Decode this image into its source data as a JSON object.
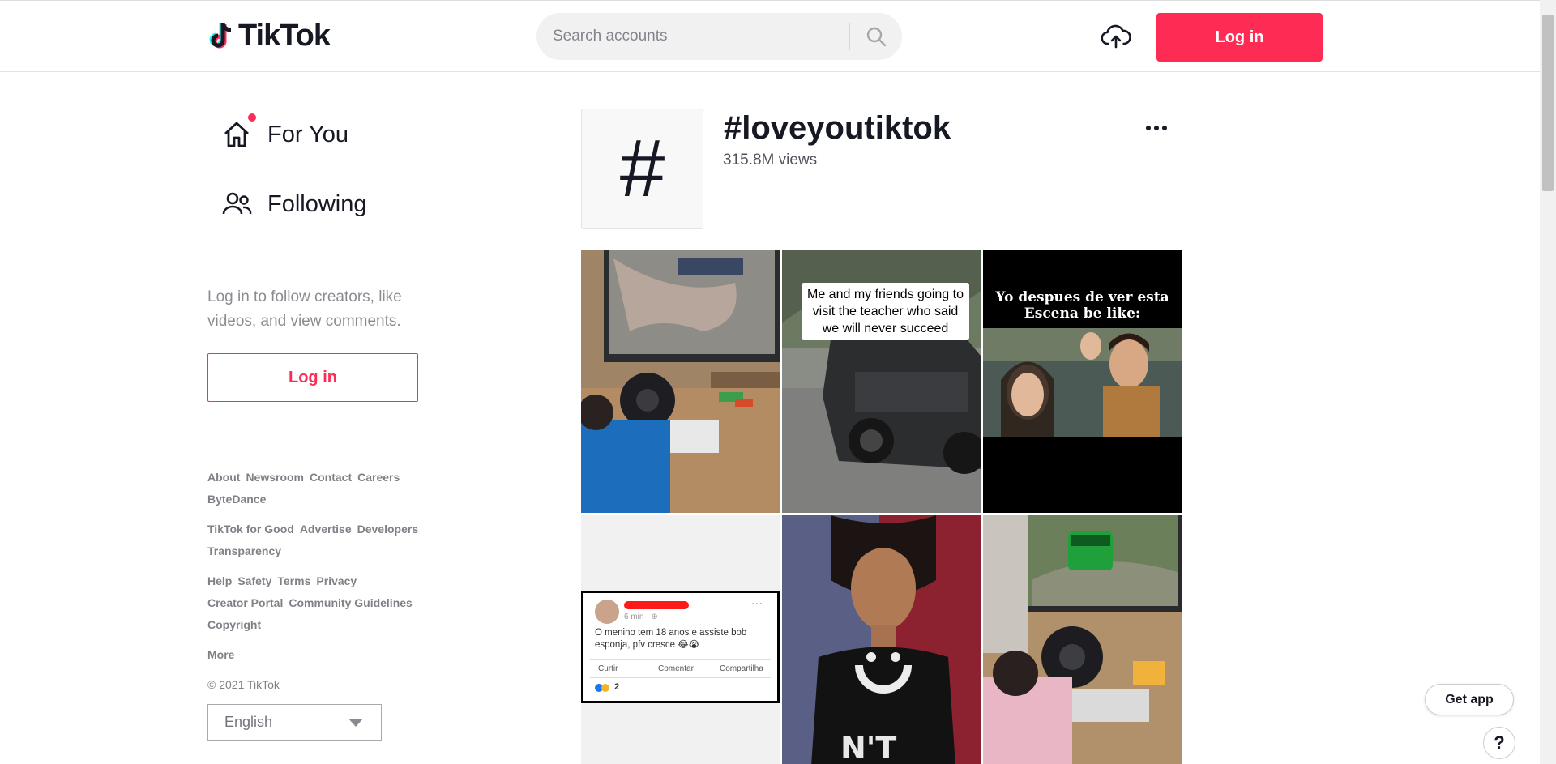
{
  "header": {
    "logo": "TikTok",
    "search_placeholder": "Search accounts",
    "login_label": "Log in"
  },
  "sidebar": {
    "nav": [
      {
        "label": "For You",
        "icon": "home-icon"
      },
      {
        "label": "Following",
        "icon": "users-icon"
      }
    ],
    "login_hint": "Log in to follow creators, like videos, and view comments.",
    "login_label": "Log in",
    "footer_rows": [
      [
        "About",
        "Newsroom",
        "Contact",
        "Careers",
        "ByteDance"
      ],
      [
        "TikTok for Good",
        "Advertise",
        "Developers",
        "Transparency"
      ],
      [
        "Help",
        "Safety",
        "Terms",
        "Privacy",
        "Creator Portal",
        "Community Guidelines",
        "Copyright"
      ],
      [
        "More"
      ],
      [
        "© 2021 TikTok"
      ]
    ],
    "language": "English"
  },
  "hashtag": {
    "symbol": "#",
    "title": "#loveyoutiktok",
    "views": "315.8M views"
  },
  "videos": {
    "caption_2": "Me and my friends going to visit the teacher who said we will never succeed",
    "caption_3": "Yo despues de ver esta Escena be like:",
    "fb_post": {
      "time": "6 min · ⊕",
      "text": "O menino tem 18 anos e assiste bob esponja, pfv cresce 😂😭",
      "actions": [
        "Curtir",
        "Comentar",
        "Compartilha"
      ],
      "reaction_count": "2"
    }
  },
  "floating": {
    "get_app": "Get app",
    "help": "?"
  },
  "colors": {
    "accent": "#fe2c55",
    "text": "#161823"
  }
}
